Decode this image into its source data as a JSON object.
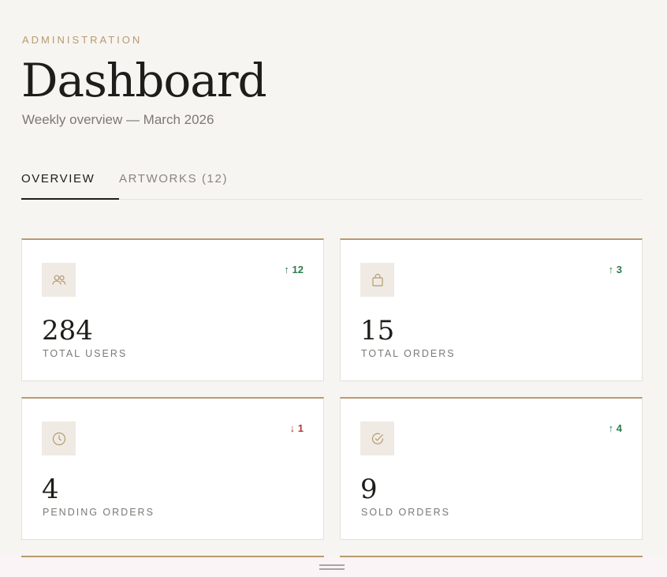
{
  "header": {
    "overline": "ADMINISTRATION",
    "title": "Dashboard",
    "subtitle": "Weekly overview — March 2026"
  },
  "tabs": [
    {
      "label": "OVERVIEW",
      "active": true
    },
    {
      "label": "ARTWORKS (12)",
      "active": false
    }
  ],
  "stats": [
    {
      "value": "284",
      "label": "TOTAL USERS",
      "delta": "↑ 12",
      "trend": "up",
      "icon": "users-icon"
    },
    {
      "value": "15",
      "label": "TOTAL ORDERS",
      "delta": "↑ 3",
      "trend": "up",
      "icon": "shopping-bag-icon"
    },
    {
      "value": "4",
      "label": "PENDING ORDERS",
      "delta": "↓ 1",
      "trend": "down",
      "icon": "clock-icon"
    },
    {
      "value": "9",
      "label": "SOLD ORDERS",
      "delta": "↑ 4",
      "trend": "up",
      "icon": "check-circle-icon"
    }
  ],
  "colors": {
    "background": "#f7f5f2",
    "accent": "#b79a6e",
    "up": "#2e7d4f",
    "down": "#b23a3a",
    "text": "#1f1d1a",
    "muted": "#7d7873"
  }
}
